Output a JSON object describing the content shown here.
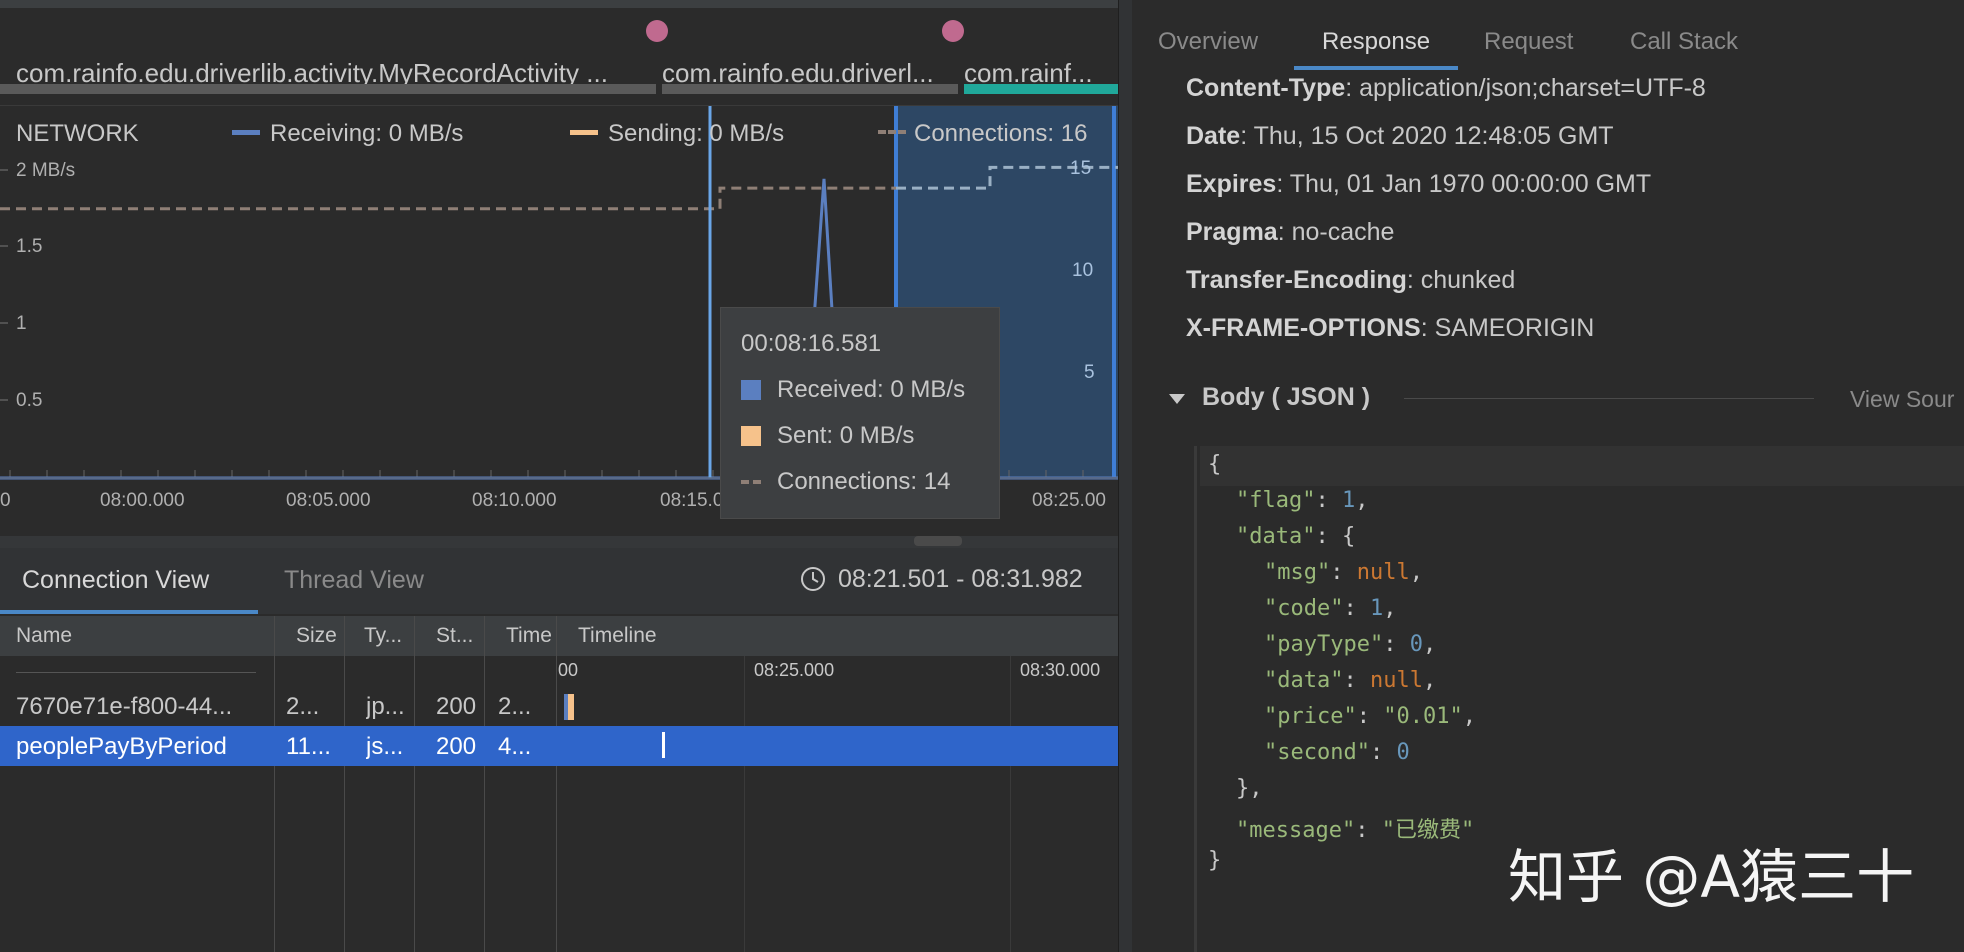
{
  "activity_bar": {
    "labels": [
      "com.rainfo.edu.driverlib.activity.MyRecordActivity ...",
      "com.rainfo.edu.driverl...",
      "com.rainf..."
    ]
  },
  "network_chart": {
    "title": "NETWORK",
    "legend": {
      "receiving": "Receiving: 0 MB/s",
      "sending": "Sending: 0 MB/s",
      "connections": "Connections: 16"
    },
    "y_left_ticks": [
      "2 MB/s",
      "1.5",
      "1",
      "0.5"
    ],
    "y_right_ticks": [
      "15",
      "10",
      "5"
    ],
    "x_ticks": [
      "0",
      "08:00.000",
      "08:05.000",
      "08:10.000",
      "08:15.0",
      "08:25.00"
    ],
    "colors": {
      "receiving": "#5b7fc0",
      "sending": "#f6c28b",
      "connections": "#8f7f76",
      "selection": "#2f5a8a",
      "cursor": "#6aa6e8"
    }
  },
  "chart_data": {
    "type": "line",
    "title": "NETWORK",
    "xlabel": "",
    "ylabel": "",
    "x": [
      "07:55",
      "08:15",
      "08:16.5",
      "08:18",
      "08:18.5",
      "08:19",
      "08:19.5",
      "08:20",
      "08:23",
      "08:25"
    ],
    "ylim": [
      0,
      2
    ],
    "series": [
      {
        "name": "Receiving",
        "values": [
          0,
          0,
          0,
          0,
          0.6,
          1.75,
          0.6,
          0,
          0,
          0
        ]
      },
      {
        "name": "Sending",
        "values": [
          0,
          0,
          0,
          0,
          0,
          0,
          0,
          0,
          0,
          0
        ]
      },
      {
        "name": "Connections",
        "values": [
          13,
          13,
          14,
          14,
          14,
          14,
          14,
          14,
          15,
          15
        ]
      }
    ],
    "y2lim": [
      0,
      17
    ],
    "legend": "top"
  },
  "tooltip": {
    "time": "00:08:16.581",
    "received": "Received: 0 MB/s",
    "sent": "Sent: 0 MB/s",
    "connections": "Connections: 14"
  },
  "conn_tabs": {
    "connection_view": "Connection View",
    "thread_view": "Thread View",
    "range": "08:21.501 - 08:31.982"
  },
  "table": {
    "headers": [
      "Name",
      "Size",
      "Ty...",
      "St...",
      "Time",
      "Timeline"
    ],
    "timeline_ticks": [
      "00",
      "08:25.000",
      "08:30.000"
    ],
    "rows": [
      {
        "name": "7670e71e-f800-44...",
        "size": "2...",
        "type": "jp...",
        "status": "200",
        "time": "2...",
        "selected": false
      },
      {
        "name": "peoplePayByPeriod",
        "size": "11...",
        "type": "js...",
        "status": "200",
        "time": "4...",
        "selected": true
      }
    ]
  },
  "right_tabs": [
    "Overview",
    "Response",
    "Request",
    "Call Stack"
  ],
  "headers": [
    {
      "key": "Content-Type",
      "value": ": application/json;charset=UTF-8"
    },
    {
      "key": "Date",
      "value": ": Thu, 15 Oct 2020 12:48:05 GMT"
    },
    {
      "key": "Expires",
      "value": ": Thu, 01 Jan 1970 00:00:00 GMT"
    },
    {
      "key": "Pragma",
      "value": ": no-cache"
    },
    {
      "key": "Transfer-Encoding",
      "value": ": chunked"
    },
    {
      "key": "X-FRAME-OPTIONS",
      "value": ": SAMEORIGIN"
    }
  ],
  "body": {
    "title": "Body ( JSON )",
    "view_source": "View Sour"
  },
  "json_lines": [
    {
      "indent": 0,
      "parts": [
        [
          "p",
          "{"
        ]
      ]
    },
    {
      "indent": 1,
      "parts": [
        [
          "k",
          "\"flag\""
        ],
        [
          "p",
          ": "
        ],
        [
          "n",
          "1"
        ],
        [
          "p",
          ","
        ]
      ]
    },
    {
      "indent": 1,
      "parts": [
        [
          "k",
          "\"data\""
        ],
        [
          "p",
          ": {"
        ]
      ]
    },
    {
      "indent": 2,
      "parts": [
        [
          "k",
          "\"msg\""
        ],
        [
          "p",
          ": "
        ],
        [
          "null",
          "null"
        ],
        [
          "p",
          ","
        ]
      ]
    },
    {
      "indent": 2,
      "parts": [
        [
          "k",
          "\"code\""
        ],
        [
          "p",
          ": "
        ],
        [
          "n",
          "1"
        ],
        [
          "p",
          ","
        ]
      ]
    },
    {
      "indent": 2,
      "parts": [
        [
          "k",
          "\"payType\""
        ],
        [
          "p",
          ": "
        ],
        [
          "n",
          "0"
        ],
        [
          "p",
          ","
        ]
      ]
    },
    {
      "indent": 2,
      "parts": [
        [
          "k",
          "\"data\""
        ],
        [
          "p",
          ": "
        ],
        [
          "null",
          "null"
        ],
        [
          "p",
          ","
        ]
      ]
    },
    {
      "indent": 2,
      "parts": [
        [
          "k",
          "\"price\""
        ],
        [
          "p",
          ": "
        ],
        [
          "s",
          "\"0.01\""
        ],
        [
          "p",
          ","
        ]
      ]
    },
    {
      "indent": 2,
      "parts": [
        [
          "k",
          "\"second\""
        ],
        [
          "p",
          ": "
        ],
        [
          "n",
          "0"
        ]
      ]
    },
    {
      "indent": 1,
      "parts": [
        [
          "p",
          "},"
        ]
      ]
    },
    {
      "indent": 1,
      "parts": [
        [
          "k",
          "\"message\""
        ],
        [
          "p",
          ": "
        ],
        [
          "s",
          "\"已缴费\""
        ]
      ]
    },
    {
      "indent": 0,
      "parts": [
        [
          "p",
          "}"
        ]
      ]
    }
  ],
  "watermark": "知乎 @A猿三十"
}
